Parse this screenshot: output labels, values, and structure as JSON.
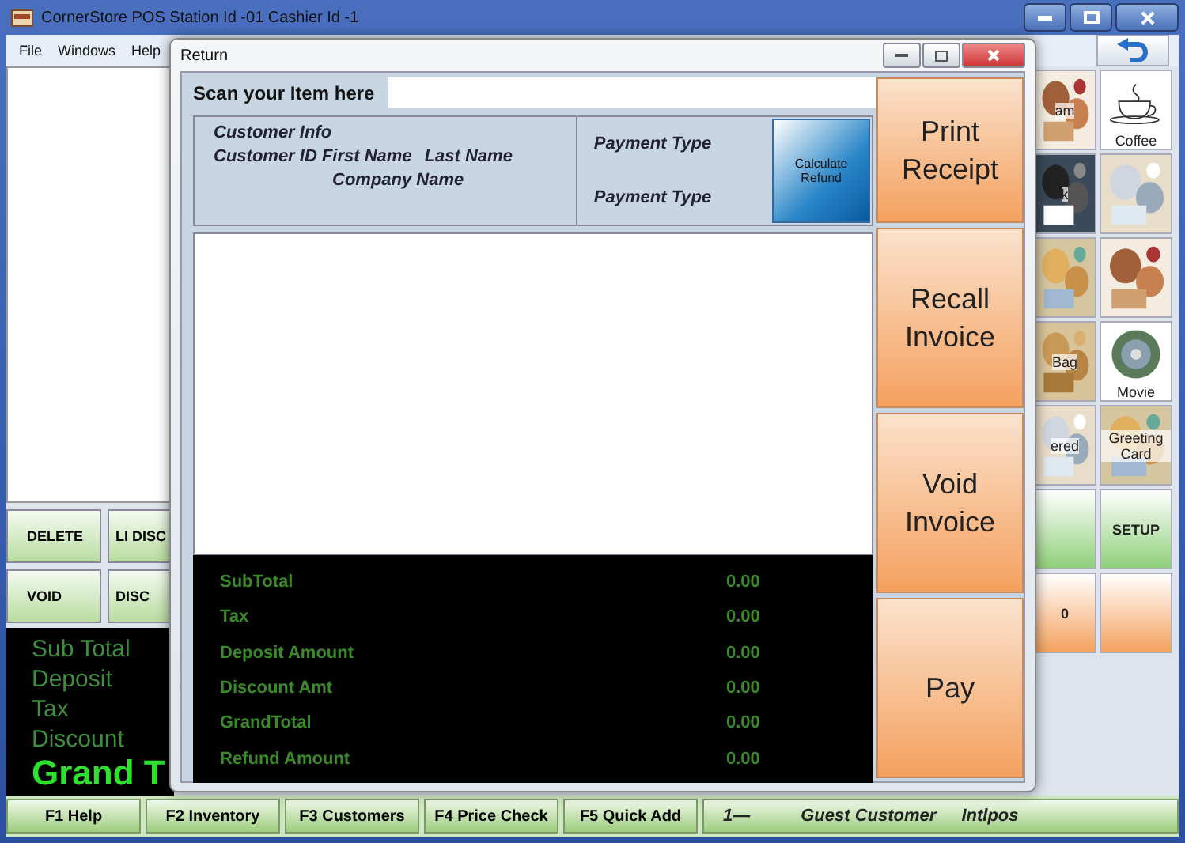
{
  "window": {
    "title": "CornerStore POS Station Id -01 Cashier Id -1"
  },
  "menu": [
    "File",
    "Windows",
    "Help"
  ],
  "left_buttons": [
    {
      "label": "DELETE"
    },
    {
      "label": "LI DISC"
    },
    {
      "label": "VOID"
    },
    {
      "label": "DISC"
    }
  ],
  "totals": [
    {
      "label": "Sub Total",
      "emphasis": false
    },
    {
      "label": "Deposit",
      "emphasis": false
    },
    {
      "label": "Tax",
      "emphasis": false
    },
    {
      "label": "Discount",
      "emphasis": false
    },
    {
      "label": "Grand T",
      "emphasis": true
    }
  ],
  "tiles": [
    {
      "kind": "picture",
      "label": "am"
    },
    {
      "kind": "cup",
      "label": "Coffee"
    },
    {
      "kind": "picture",
      "label": "k"
    },
    {
      "kind": "picture"
    },
    {
      "kind": "picture"
    },
    {
      "kind": "picture"
    },
    {
      "kind": "picture",
      "label": "Bag"
    },
    {
      "kind": "disc",
      "label": "Movie"
    },
    {
      "kind": "picture",
      "label": "ered"
    },
    {
      "kind": "picture",
      "label": "Greeting Card"
    },
    {
      "kind": "button",
      "color": "#8fd07a"
    },
    {
      "kind": "button",
      "color": "#8fd07a",
      "label": "SETUP"
    },
    {
      "kind": "button",
      "color": "#f4a25e",
      "label": "0"
    },
    {
      "kind": "button",
      "color": "#f4a25e"
    }
  ],
  "function_bar": [
    "F1 Help",
    "F2 Inventory",
    "F3 Customers",
    "F4 Price Check",
    "F5 Quick Add"
  ],
  "status": {
    "number": "1—",
    "customer": "Guest Customer",
    "user": "Intlpos"
  },
  "dialog": {
    "title": "Return",
    "scan_label": "Scan your Item here",
    "customer_info": {
      "heading": "Customer Info",
      "id_first": "Customer ID First Name",
      "last": "Last Name",
      "company": "Company Name"
    },
    "payment_types": [
      "Payment Type",
      "Payment Type"
    ],
    "calculate_button": "Calculate Refund",
    "totals": [
      {
        "label": "SubTotal",
        "value": "0.00"
      },
      {
        "label": "Tax",
        "value": "0.00"
      },
      {
        "label": "Deposit Amount",
        "value": "0.00"
      },
      {
        "label": "Discount Amt",
        "value": "0.00"
      },
      {
        "label": "GrandTotal",
        "value": "0.00"
      },
      {
        "label": "Refund Amount",
        "value": "0.00"
      }
    ],
    "actions": [
      "Print Receipt",
      "Recall Invoice",
      "Void Invoice",
      "Pay"
    ]
  }
}
